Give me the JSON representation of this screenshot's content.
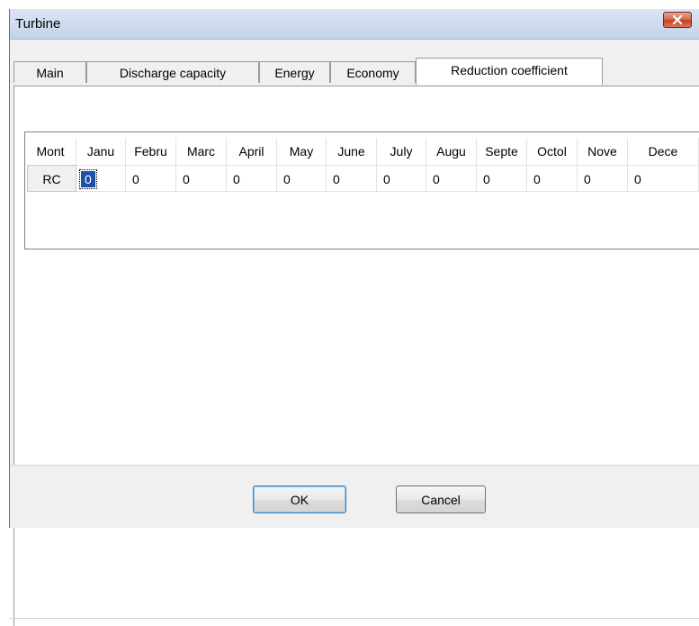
{
  "window": {
    "title": "Turbine"
  },
  "tabs": [
    {
      "label": "Main"
    },
    {
      "label": "Discharge capacity"
    },
    {
      "label": "Energy"
    },
    {
      "label": "Economy"
    },
    {
      "label": "Reduction coefficient",
      "active": true
    }
  ],
  "grid": {
    "header": [
      "Mont",
      "Janu",
      "Febru",
      "Marc",
      "April",
      "May",
      "June",
      "July",
      "Augu",
      "Septe",
      "Octol",
      "Nove",
      "Dece"
    ],
    "rows": [
      {
        "label": "RC",
        "values": [
          "0",
          "0",
          "0",
          "0",
          "0",
          "0",
          "0",
          "0",
          "0",
          "0",
          "0",
          "0"
        ],
        "selected_index": 0
      }
    ]
  },
  "buttons": {
    "ok": "OK",
    "cancel": "Cancel"
  },
  "colors": {
    "selection": "#1b4fa8",
    "close_button": "#c2421f"
  },
  "icons": {
    "close": "close-icon"
  }
}
